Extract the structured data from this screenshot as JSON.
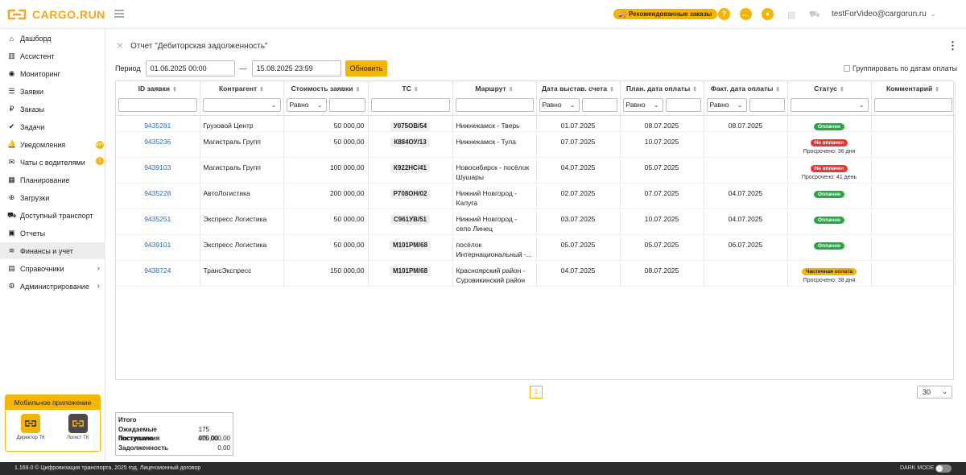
{
  "app": {
    "brand": "CARGO.RUN"
  },
  "header": {
    "recommended_label": "Рекомендованные заказы",
    "user_email": "testForVideo@cargorun.ru"
  },
  "sidebar": {
    "items": [
      {
        "label": "Дашборд",
        "icon": "dashboard-icon"
      },
      {
        "label": "Ассистент",
        "icon": "chart-icon"
      },
      {
        "label": "Мониторинг",
        "icon": "location-icon"
      },
      {
        "label": "Заявки",
        "icon": "list-icon"
      },
      {
        "label": "Заказы",
        "icon": "ruble-icon"
      },
      {
        "label": "Задачи",
        "icon": "check-icon"
      },
      {
        "label": "Уведомления",
        "icon": "bell-icon",
        "badge": "99+"
      },
      {
        "label": "Чаты с водителями",
        "icon": "chat-icon",
        "badge": "1"
      },
      {
        "label": "Планирование",
        "icon": "calendar-icon"
      },
      {
        "label": "Загрузки",
        "icon": "download-icon"
      },
      {
        "label": "Доступный транспорт",
        "icon": "truck-icon"
      },
      {
        "label": "Отчеты",
        "icon": "report-icon"
      },
      {
        "label": "Финансы и учет",
        "icon": "finance-icon",
        "active": true
      },
      {
        "label": "Справочники",
        "icon": "book-icon",
        "chevron": true
      },
      {
        "label": "Администрирование",
        "icon": "admin-icon",
        "chevron": true
      }
    ],
    "mobile_app": {
      "title": "Мобильное приложение",
      "apps": [
        {
          "label": "Директор ТК",
          "color": "#f5b400"
        },
        {
          "label": "Логист ТК",
          "color": "#4a4a4a"
        }
      ]
    }
  },
  "report": {
    "title": "Отчет \"Дебиторская задолженность\"",
    "period_label": "Период",
    "date_from": "01.06.2025 00:00",
    "dash": "—",
    "date_to": "15.08.2025 23:59",
    "update_label": "Обновить",
    "group_label": "Группировать по датам оплаты"
  },
  "table": {
    "headers": [
      "ID заявки",
      "Контрагент",
      "Стоимость заявки",
      "ТС",
      "Маршрут",
      "Дата выстав. счета",
      "План. дата оплаты",
      "Факт. дата оплаты",
      "Статус",
      "Комментарий"
    ],
    "filter_equal": "Равно",
    "rows": [
      {
        "id": "9435281",
        "contractor": "Грузовой Центр",
        "cost": "50 000,00",
        "plate": "У075ОВ/54",
        "route": "Нижнекамск - Тверь",
        "invoice_date": "01.07.2025",
        "plan_date": "08.07.2025",
        "fact_date": "08.07.2025",
        "status": "Оплачен",
        "status_color": "green",
        "overdue": ""
      },
      {
        "id": "9435236",
        "contractor": "Магистраль Групп",
        "cost": "50 000,00",
        "plate": "К884ОУ/13",
        "route": "Нижнекамск - Тула",
        "invoice_date": "07.07.2025",
        "plan_date": "10.07.2025",
        "fact_date": "",
        "status": "Не оплачен",
        "status_color": "red",
        "overdue": "Просрочено: 36 дня"
      },
      {
        "id": "9439103",
        "contractor": "Магистраль Групп",
        "cost": "100 000,00",
        "plate": "К922НС/41",
        "route": "Новосибирск - посёлок Шушары",
        "invoice_date": "04.07.2025",
        "plan_date": "05.07.2025",
        "fact_date": "",
        "status": "Не оплачен",
        "status_color": "red",
        "overdue": "Просрочено: 41 день"
      },
      {
        "id": "9435228",
        "contractor": "АвтоЛогистика",
        "cost": "200 000,00",
        "plate": "Р708ОН/02",
        "route": "Нижний Новгород - Калуга",
        "invoice_date": "02.07.2025",
        "plan_date": "07.07.2025",
        "fact_date": "04.07.2025",
        "status": "Оплачен",
        "status_color": "green",
        "overdue": ""
      },
      {
        "id": "9435251",
        "contractor": "Экспресс Логистика",
        "cost": "50 000,00",
        "plate": "С961УВ/51",
        "route": "Нижний Новгород - село Линец",
        "invoice_date": "03.07.2025",
        "plan_date": "10.07.2025",
        "fact_date": "04.07.2025",
        "status": "Оплачен",
        "status_color": "green",
        "overdue": ""
      },
      {
        "id": "9439101",
        "contractor": "Экспресс Логистика",
        "cost": "50 000,00",
        "plate": "М101РМ/68",
        "route": "посёлок Интернациональный -...",
        "invoice_date": "05.07.2025",
        "plan_date": "05.07.2025",
        "fact_date": "06.07.2025",
        "status": "Оплачен",
        "status_color": "green",
        "overdue": ""
      },
      {
        "id": "9438724",
        "contractor": "ТрансЭкспресс",
        "cost": "150 000,00",
        "plate": "М101РМ/68",
        "route": "Красноярский район - Суровикинский район",
        "invoice_date": "04.07.2025",
        "plan_date": "08.07.2025",
        "fact_date": "",
        "status": "Частичная оплата",
        "status_color": "yellow",
        "overdue": "Просрочено: 38 дня"
      }
    ]
  },
  "pagination": {
    "current": "1",
    "per_page": "30"
  },
  "totals": {
    "title": "Итого",
    "rows": [
      {
        "label": "Ожидаемые поступления",
        "value": "175 000,00"
      },
      {
        "label": "Поступило",
        "value": "475 000,00"
      },
      {
        "label": "Задолженность",
        "value": "0,00"
      }
    ]
  },
  "footer": {
    "text": "1.169.0 © Цифровизация транспорта, 2025 год.  Лицензионный договор",
    "dark_mode": "DARK MODE"
  },
  "colors": {
    "accent": "#f5b400",
    "link": "#2b6cb0",
    "paid": "#27a844",
    "unpaid": "#e53935"
  }
}
